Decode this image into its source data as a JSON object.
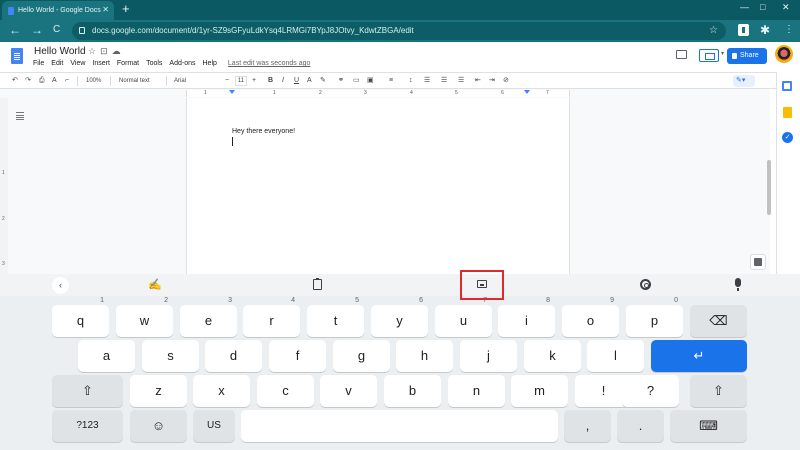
{
  "browser": {
    "tab_title": "Hello World - Google Docs",
    "new_tab": "+",
    "url": "docs.google.com/document/d/1yr-SZ9sGFyuLdkYsq4LRMGi7BYpJ8JOtvy_KdwtZBGA/edit",
    "back": "←",
    "forward": "→",
    "reload": "C",
    "minimize": "—",
    "maximize": "□",
    "close": "✕"
  },
  "docs": {
    "title": "Hello World",
    "title_icons": "☆⊡☁",
    "menu": [
      "File",
      "Edit",
      "View",
      "Insert",
      "Format",
      "Tools",
      "Add-ons",
      "Help"
    ],
    "last_edit": "Last edit was seconds ago",
    "share_label": "Share"
  },
  "toolbar": {
    "undo": "↶",
    "redo": "↷",
    "print": "⎙",
    "spell": "A",
    "paint": "⌐",
    "zoom": "100%",
    "style": "Normal text",
    "font": "Arial",
    "minus": "−",
    "font_size": "11",
    "plus": "+",
    "bold": "B",
    "italic": "I",
    "underline": "U",
    "text_color": "A",
    "highlight": "✎",
    "link": "⚭",
    "comment": "▭",
    "image": "▣",
    "align": "≡",
    "line_spacing": "↕",
    "checklist": "☰",
    "bullets": "☰",
    "numbers": "☰",
    "indent_less": "⇤",
    "indent_more": "⇥",
    "clear": "⊘",
    "edit_mode": "✎▾"
  },
  "ruler": {
    "numbers": [
      "1",
      "1",
      "2",
      "3",
      "4",
      "5",
      "6",
      "7"
    ],
    "vnumbers": [
      "1",
      "2",
      "3"
    ]
  },
  "document": {
    "text": "Hey there everyone!"
  },
  "keyboard": {
    "toolbar": {
      "back": "‹",
      "handwriting": "✍"
    },
    "rows": [
      [
        {
          "label": "q",
          "hint": "1"
        },
        {
          "label": "w",
          "hint": "2"
        },
        {
          "label": "e",
          "hint": "3"
        },
        {
          "label": "r",
          "hint": "4"
        },
        {
          "label": "t",
          "hint": "5"
        },
        {
          "label": "y",
          "hint": "6"
        },
        {
          "label": "u",
          "hint": "7"
        },
        {
          "label": "i",
          "hint": "8"
        },
        {
          "label": "o",
          "hint": "9"
        },
        {
          "label": "p",
          "hint": "0"
        },
        {
          "label": "⌫",
          "hint": ""
        }
      ],
      [
        {
          "label": "a"
        },
        {
          "label": "s"
        },
        {
          "label": "d"
        },
        {
          "label": "f"
        },
        {
          "label": "g"
        },
        {
          "label": "h"
        },
        {
          "label": "j"
        },
        {
          "label": "k"
        },
        {
          "label": "l"
        },
        {
          "label": "↵"
        }
      ],
      [
        {
          "label": "⇧"
        },
        {
          "label": "z"
        },
        {
          "label": "x"
        },
        {
          "label": "c"
        },
        {
          "label": "v"
        },
        {
          "label": "b"
        },
        {
          "label": "n"
        },
        {
          "label": "m"
        },
        {
          "label": "!"
        },
        {
          "label": "?"
        },
        {
          "label": "⇧"
        }
      ],
      [
        {
          "label": "?123"
        },
        {
          "label": "☺"
        },
        {
          "label": "US"
        },
        {
          "label": ""
        },
        {
          "label": ","
        },
        {
          "label": "."
        },
        {
          "label": "⌨"
        }
      ]
    ]
  },
  "colors": {
    "chrome_dark": "#0b5a63",
    "chrome": "#1a7480",
    "accent": "#1a73e8",
    "highlight_box": "#e0292d"
  }
}
